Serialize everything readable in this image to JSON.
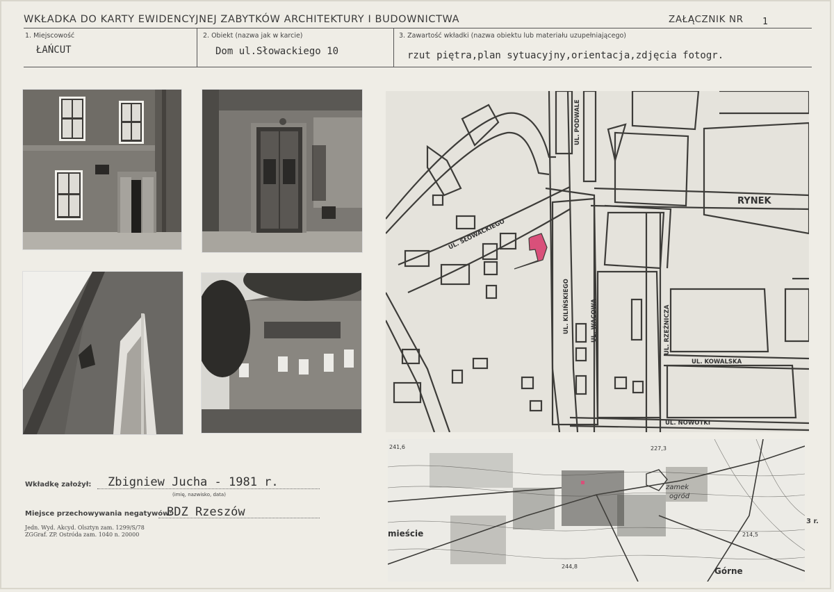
{
  "header": {
    "title": "WKŁADKA DO KARTY EWIDENCYJNEJ ZABYTKÓW ARCHITEKTURY I BUDOWNICTWA",
    "attachment_label": "ZAŁĄCZNIK NR",
    "attachment_number": "1"
  },
  "fields": [
    {
      "label": "1. Miejscowość",
      "value": "ŁAŃCUT"
    },
    {
      "label": "2. Obiekt (nazwa jak w karcie)",
      "value": "Dom ul.Słowackiego 10"
    },
    {
      "label": "3. Zawartość wkładki (nazwa obiektu lub materiału uzupełniającego)",
      "value": "rzut piętra,plan sytuacyjny,orientacja,zdjęcia fotogr."
    }
  ],
  "map": {
    "rynek": "RYNEK",
    "streets": {
      "podwale": "UL. PODWALE",
      "slowackiego": "UL. SŁOWACKIEGO",
      "kilinskiego": "UL. KILIŃSKIEGO",
      "wacowa": "UL. WACOWA",
      "rzeznicza": "UL. RZEŹNICZA",
      "kowalska": "UL. KOWALSKA",
      "nowotki": "UL. NOWOTKI"
    },
    "highlight_color": "#d9507a"
  },
  "topo": {
    "labels": {
      "h1": "241,6",
      "h2": "227,3",
      "zamek": "zamek",
      "ogrod": "ogród",
      "h3": "214,5",
      "h4": "244,8",
      "miescie": "mieście",
      "gorne": "Górne",
      "r": "3 r."
    }
  },
  "footer": {
    "creator_label": "Wkładkę założył:",
    "creator_value": "Zbigniew Jucha - 1981 r.",
    "creator_hint": "(imię, nazwisko, data)",
    "storage_label": "Miejsce przechowywania negatywów:",
    "storage_value": "BDZ Rzeszów",
    "imprint1": "Jedn. Wyd. Akcyd. Olsztyn zam. 1299/S/78",
    "imprint2": "ZGGraf. ZP. Ostróda zam. 1040 n. 20000"
  }
}
